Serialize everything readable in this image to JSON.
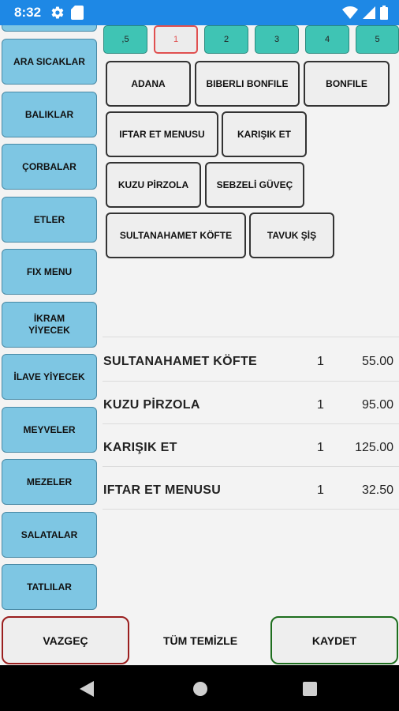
{
  "status_bar": {
    "time": "8:32",
    "left_icons": [
      "gear-icon",
      "sd-card-icon"
    ],
    "right_icons": [
      "wifi-icon",
      "signal-icon",
      "battery-icon"
    ]
  },
  "sidebar": {
    "items": [
      {
        "label": ""
      },
      {
        "label": "ARA SICAKLAR"
      },
      {
        "label": "BALIKLAR"
      },
      {
        "label": "ÇORBALAR"
      },
      {
        "label": "ETLER"
      },
      {
        "label": "FIX MENU"
      },
      {
        "label": "İKRAM YİYECEK"
      },
      {
        "label": "İLAVE YİYECEK"
      },
      {
        "label": "MEYVELER"
      },
      {
        "label": "MEZELER"
      },
      {
        "label": "SALATALAR"
      },
      {
        "label": "TATLILAR"
      }
    ]
  },
  "pagination": {
    "items": [
      ",5",
      "1",
      "2",
      "3",
      "4",
      "5"
    ],
    "active": "1",
    "active_color": "#e05050",
    "color": "#3fc4b4"
  },
  "menu_items": {
    "items": [
      "ADANA",
      "BIBERLI BONFILE",
      "BONFILE",
      "IFTAR ET MENUSU",
      "KARIŞIK ET",
      "KUZU PİRZOLA",
      "SEBZELİ GÜVEÇ",
      "SULTANAHAMET KÖFTE",
      "TAVUK ŞİŞ"
    ]
  },
  "order": {
    "rows": [
      {
        "name": "SULTANAHAMET KÖFTE",
        "qty": "1",
        "price": "55.00"
      },
      {
        "name": "KUZU PİRZOLA",
        "qty": "1",
        "price": "95.00"
      },
      {
        "name": "KARIŞIK ET",
        "qty": "1",
        "price": "125.00"
      },
      {
        "name": "IFTAR ET MENUSU",
        "qty": "1",
        "price": "32.50"
      }
    ]
  },
  "actions": {
    "cancel": "VAZGEÇ",
    "clear_all": "TÜM TEMİZLE",
    "save": "KAYDET",
    "cancel_color": "#9a1e1e",
    "save_color": "#1e6e1e"
  },
  "nav_bar": {
    "icons": [
      "back-icon",
      "home-icon",
      "recents-icon"
    ]
  }
}
